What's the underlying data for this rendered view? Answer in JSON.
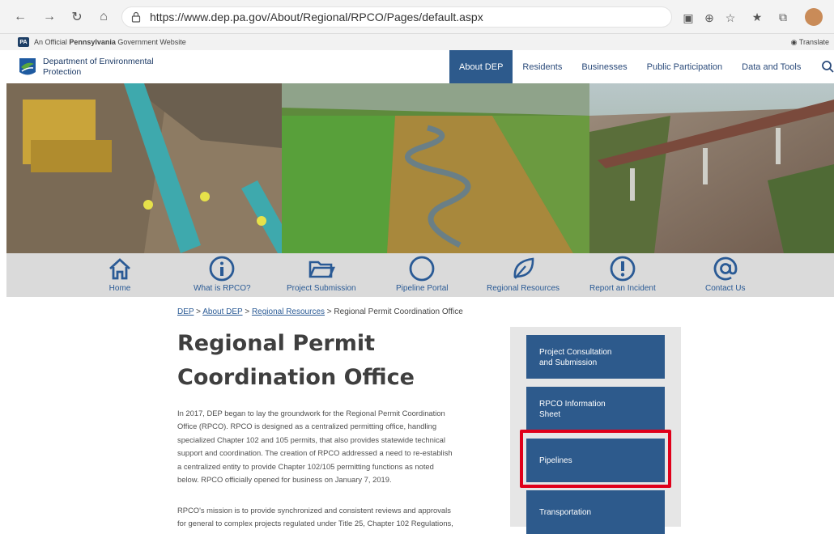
{
  "browser": {
    "url": "https://www.dep.pa.gov/About/Regional/RPCO/Pages/default.aspx"
  },
  "govbar": {
    "badge": "PA",
    "official_prefix": "An Official ",
    "official_bold": "Pennsylvania",
    "official_suffix": " Government Website",
    "translate": "Translate"
  },
  "header": {
    "org_line1": "Department of Environmental",
    "org_line2": "Protection",
    "nav": [
      "About DEP",
      "Residents",
      "Businesses",
      "Public Participation",
      "Data and Tools"
    ],
    "active_nav": "About DEP"
  },
  "iconbar": {
    "items": [
      {
        "label": "Home",
        "icon": "home-icon"
      },
      {
        "label": "What is RPCO?",
        "icon": "info-icon"
      },
      {
        "label": "Project Submission",
        "icon": "folder-icon"
      },
      {
        "label": "Pipeline Portal",
        "icon": "circle-icon"
      },
      {
        "label": "Regional Resources",
        "icon": "leaf-icon"
      },
      {
        "label": "Report an Incident",
        "icon": "alert-icon"
      },
      {
        "label": "Contact Us",
        "icon": "at-icon"
      }
    ]
  },
  "breadcrumb": {
    "dep": "DEP",
    "sep": ">",
    "about": "About DEP",
    "regional": "Regional Resources",
    "current": "Regional Permit Coordination Office"
  },
  "page": {
    "title_line1": "Regional Permit",
    "title_line2": "Coordination Office",
    "para1_lines": [
      "In 2017, DEP began to lay the groundwork for the Regional Permit Coordination",
      "Office (RPCO).  RPCO is designed as a centralized permitting office, handling",
      "specialized Chapter 102 and 105 permits, that also provides statewide technical",
      "support and coordination.  The creation of RPCO addressed a need to re-establish",
      "a centralized entity to provide Chapter 102/105 permitting functions as noted",
      "below.  RPCO officially opened for business on January 7, 2019."
    ],
    "para2_lines": [
      "RPCO's mission is to provide synchronized and consistent reviews and approvals",
      "for general to complex projects regulated under Title 25, Chapter 102 Regulations,"
    ]
  },
  "sidebar": {
    "buttons": [
      {
        "line1": "Project Consultation",
        "line2": "and Submission"
      },
      {
        "line1": "RPCO Information",
        "line2": "Sheet"
      },
      {
        "line1": "Pipelines",
        "line2": ""
      },
      {
        "line1": "Transportation",
        "line2": ""
      }
    ],
    "highlighted": "Pipelines"
  },
  "colors": {
    "nav_blue": "#2d5a8c",
    "link_blue": "#2a5a95",
    "highlight_red": "#e0001a"
  }
}
